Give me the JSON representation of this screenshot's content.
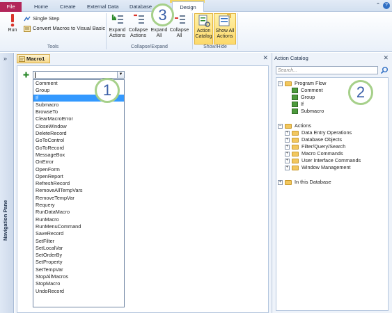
{
  "ribbon_tabs": {
    "file": "File",
    "home": "Home",
    "create": "Create",
    "external_data": "External Data",
    "database": "Database",
    "design": "Design"
  },
  "ribbon": {
    "tools": {
      "label": "Tools",
      "run": "Run",
      "single_step": "Single Step",
      "convert": "Convert Macros to Visual Basic"
    },
    "collapse_expand": {
      "label": "Collapse/Expand",
      "expand_actions": [
        "Expand",
        "Actions"
      ],
      "collapse_actions": [
        "Collapse",
        "Actions"
      ],
      "expand_all": [
        "Expand",
        "All"
      ],
      "collapse_all": [
        "Collapse",
        "All"
      ]
    },
    "show_hide": {
      "label": "Show/Hide",
      "action_catalog": [
        "Action",
        "Catalog"
      ],
      "show_all_actions": [
        "Show All",
        "Actions"
      ]
    }
  },
  "callouts": [
    "1",
    "2",
    "3"
  ],
  "navigation_pane": {
    "label": "Navigation Pane"
  },
  "document": {
    "tab": "Macro1",
    "combo_value": "",
    "dropdown_items": [
      "Comment",
      "Group",
      "If",
      "Submacro",
      "BrowseTo",
      "ClearMacroError",
      "CloseWindow",
      "DeleteRecord",
      "GoToControl",
      "GoToRecord",
      "MessageBox",
      "OnError",
      "OpenForm",
      "OpenReport",
      "RefreshRecord",
      "RemoveAllTempVars",
      "RemoveTempVar",
      "Requery",
      "RunDataMacro",
      "RunMacro",
      "RunMenuCommand",
      "SaveRecord",
      "SetFilter",
      "SetLocalVar",
      "SetOrderBy",
      "SetProperty",
      "SetTempVar",
      "StopAllMacros",
      "StopMacro",
      "UndoRecord"
    ],
    "selected_item": "If"
  },
  "catalog": {
    "title": "Action Catalog",
    "search_placeholder": "Search...",
    "program_flow": {
      "label": "Program Flow",
      "items": [
        "Comment",
        "Group",
        "If",
        "Submacro"
      ]
    },
    "actions": {
      "label": "Actions",
      "items": [
        "Data Entry Operations",
        "Database Objects",
        "Filter/Query/Search",
        "Macro Commands",
        "User Interface Commands",
        "Window Management"
      ]
    },
    "in_this_database": "In this Database"
  },
  "colors": {
    "file_tab": "#b2265a",
    "selection": "#3399ff",
    "callout_ring": "#a6d08a",
    "callout_text": "#3a5fa8"
  }
}
